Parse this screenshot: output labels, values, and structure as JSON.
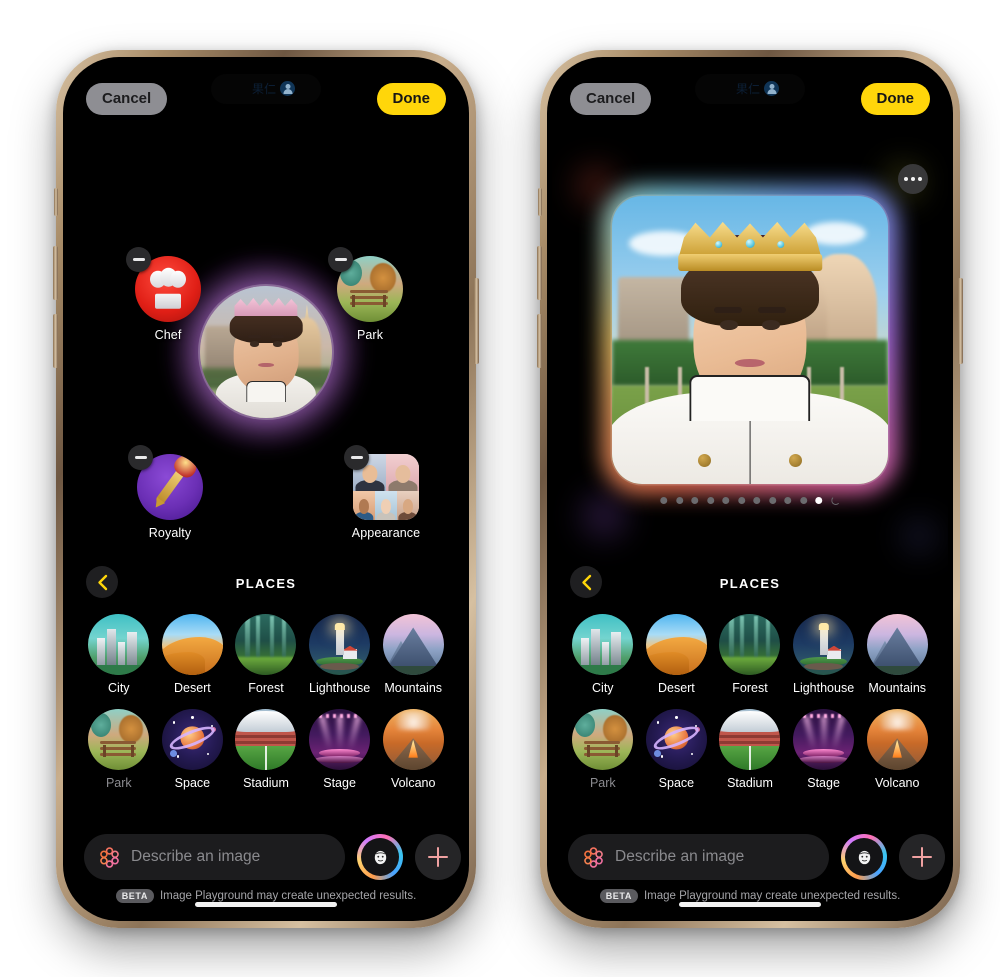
{
  "app": {
    "name": "Image Playground",
    "status_ghost_text": "果仁",
    "status_ghost_icon": "person-circle-icon"
  },
  "topbar": {
    "cancel_label": "Cancel",
    "done_label": "Done",
    "cancel_color": "#8e8e93",
    "done_color": "#ffd60a"
  },
  "left_phone": {
    "concepts": [
      {
        "label": "Chef",
        "icon": "chef-hat-icon",
        "remove": "remove-concept-button",
        "position": "top-left"
      },
      {
        "label": "Park",
        "icon": "park-bench-icon",
        "remove": "remove-concept-button",
        "position": "top-right"
      },
      {
        "label": "Royalty",
        "icon": "scepter-icon",
        "remove": "remove-concept-button",
        "position": "bottom-left"
      },
      {
        "label": "Appearance",
        "icon": "faces-grid-icon",
        "remove": "remove-concept-button",
        "position": "bottom-right"
      }
    ],
    "center_preview": {
      "name": "generated-portrait-preview"
    }
  },
  "right_phone": {
    "more_button": "more-options-button",
    "result_image": {
      "name": "generated-image-result"
    },
    "pagination": {
      "total": 11,
      "active_index": 10,
      "loading": true,
      "inactive_color": "#6b6b6e",
      "active_color": "#ffffff"
    }
  },
  "picker": {
    "back_button": "back-button",
    "back_icon_color": "#ffd60a",
    "title": "PLACES",
    "items": [
      {
        "label": "City",
        "icon": "city-icon",
        "used": false
      },
      {
        "label": "Desert",
        "icon": "desert-icon",
        "used": false
      },
      {
        "label": "Forest",
        "icon": "forest-icon",
        "used": false
      },
      {
        "label": "Lighthouse",
        "icon": "lighthouse-icon",
        "used": false
      },
      {
        "label": "Mountains",
        "icon": "mountains-icon",
        "used": false
      },
      {
        "label": "Park",
        "icon": "park-icon",
        "used": true
      },
      {
        "label": "Space",
        "icon": "space-icon",
        "used": false
      },
      {
        "label": "Stadium",
        "icon": "stadium-icon",
        "used": false
      },
      {
        "label": "Stage",
        "icon": "stage-icon",
        "used": false
      },
      {
        "label": "Volcano",
        "icon": "volcano-icon",
        "used": false
      }
    ]
  },
  "composer": {
    "prompt_icon": "playground-flower-icon",
    "prompt_value": "",
    "prompt_placeholder": "Describe an image",
    "face_button": "choose-person-button",
    "add_button": "add-concept-button",
    "plus_color": "#f0a1a1"
  },
  "disclaimer": {
    "badge": "BETA",
    "text": "Image Playground may create unexpected results."
  }
}
